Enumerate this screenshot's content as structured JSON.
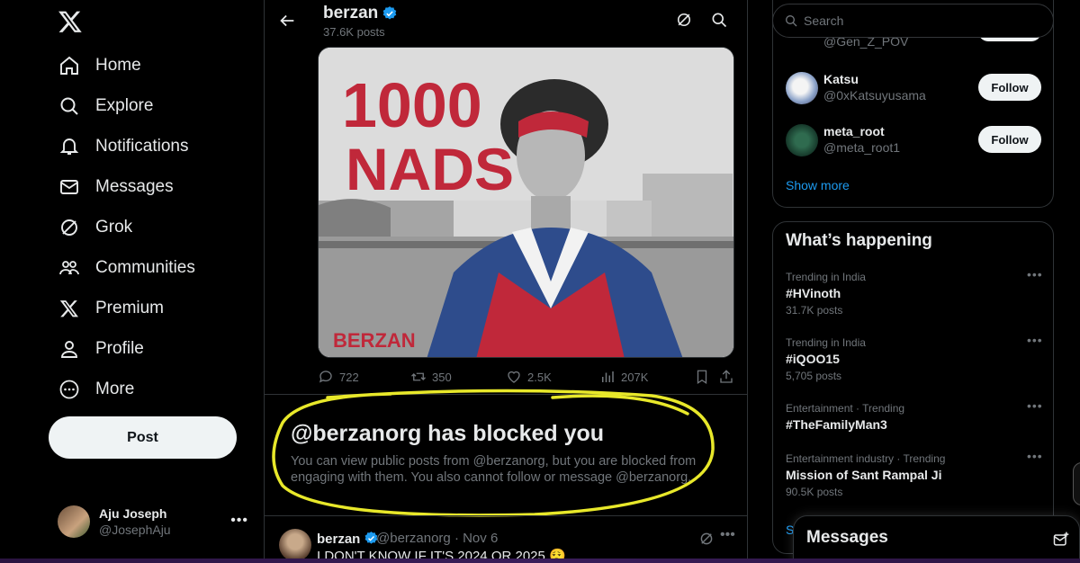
{
  "nav": {
    "items": [
      {
        "label": "Home",
        "icon": "home-icon"
      },
      {
        "label": "Explore",
        "icon": "search-icon"
      },
      {
        "label": "Notifications",
        "icon": "bell-icon"
      },
      {
        "label": "Messages",
        "icon": "envelope-icon"
      },
      {
        "label": "Grok",
        "icon": "grok-icon"
      },
      {
        "label": "Communities",
        "icon": "people-icon"
      },
      {
        "label": "Premium",
        "icon": "x-logo-icon"
      },
      {
        "label": "Profile",
        "icon": "person-icon"
      },
      {
        "label": "More",
        "icon": "more-circle-icon"
      }
    ],
    "post_label": "Post"
  },
  "account": {
    "name": "Aju Joseph",
    "handle": "@JosephAju"
  },
  "header": {
    "title": "berzan",
    "posts_count": "37.6K posts"
  },
  "media": {
    "headline_line1": "1000",
    "headline_line2": "NADS",
    "signature": "BERZAN"
  },
  "actions": {
    "replies": "722",
    "reposts": "350",
    "likes": "2.5K",
    "views": "207K"
  },
  "blocked": {
    "title": "@berzanorg has blocked you",
    "body": "You can view public posts from @berzanorg, but you are blocked from engaging with them. You also cannot follow or message @berzanorg."
  },
  "reply": {
    "name": "berzan",
    "meta": "@berzanorg · Nov 6",
    "text": "I DON'T KNOW IF IT'S 2024 OR 2025 😮‍💨"
  },
  "search": {
    "placeholder": "Search"
  },
  "who_to_follow": {
    "partial_handle": "@Gen_Z_POV",
    "people": [
      {
        "name": "Katsu",
        "handle": "@0xKatsuyusama",
        "follow_label": "Follow"
      },
      {
        "name": "meta_root",
        "handle": "@meta_root1",
        "follow_label": "Follow"
      }
    ],
    "show_more": "Show more"
  },
  "trends": {
    "title": "What’s happening",
    "items": [
      {
        "context": "Trending in India",
        "name": "#HVinoth",
        "posts": "31.7K posts"
      },
      {
        "context": "Trending in India",
        "name": "#iQOO15",
        "posts": "5,705 posts"
      },
      {
        "context": "Entertainment · Trending",
        "name": "#TheFamilyMan3",
        "posts": ""
      },
      {
        "context": "Entertainment industry · Trending",
        "name": "Mission of Sant Rampal Ji",
        "posts": "90.5K posts"
      }
    ],
    "show_more_partial": "S"
  },
  "messages_drawer": {
    "title": "Messages"
  },
  "colors": {
    "accent": "#1d9bf0",
    "highlight": "#e8e82a",
    "poster_red": "#c0283a"
  }
}
